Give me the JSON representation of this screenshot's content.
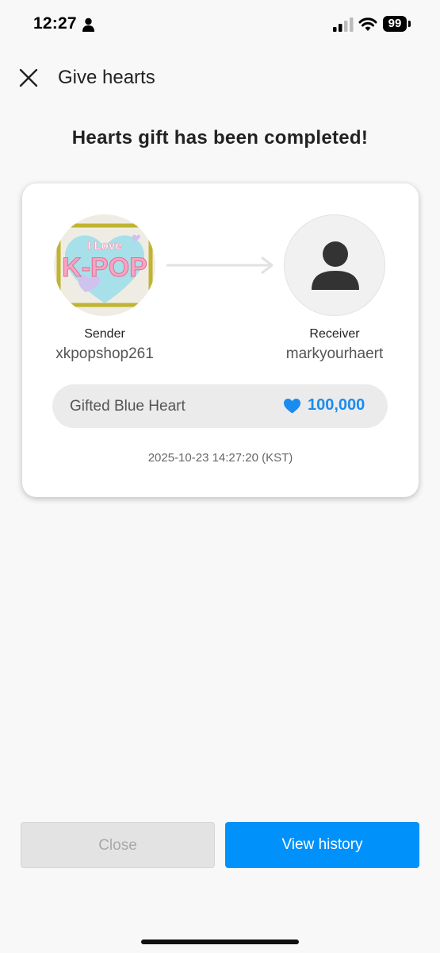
{
  "status_bar": {
    "time": "12:27",
    "battery": "99"
  },
  "header": {
    "title": "Give hearts"
  },
  "completed_message": "Hearts gift has been completed!",
  "card": {
    "sender": {
      "role": "Sender",
      "name": "xkpopshop261",
      "avatar_text_top": "I Love",
      "avatar_text_main": "K-POP"
    },
    "receiver": {
      "role": "Receiver",
      "name": "markyourhaert"
    },
    "gift": {
      "label": "Gifted Blue Heart",
      "amount": "100,000",
      "icon": "blue-heart-icon",
      "amount_color": "#1a8cf0"
    },
    "timestamp": "2025-10-23 14:27:20 (KST)"
  },
  "buttons": {
    "close_label": "Close",
    "history_label": "View history"
  },
  "colors": {
    "accent": "#0091fb",
    "background": "#f8f8f8"
  }
}
